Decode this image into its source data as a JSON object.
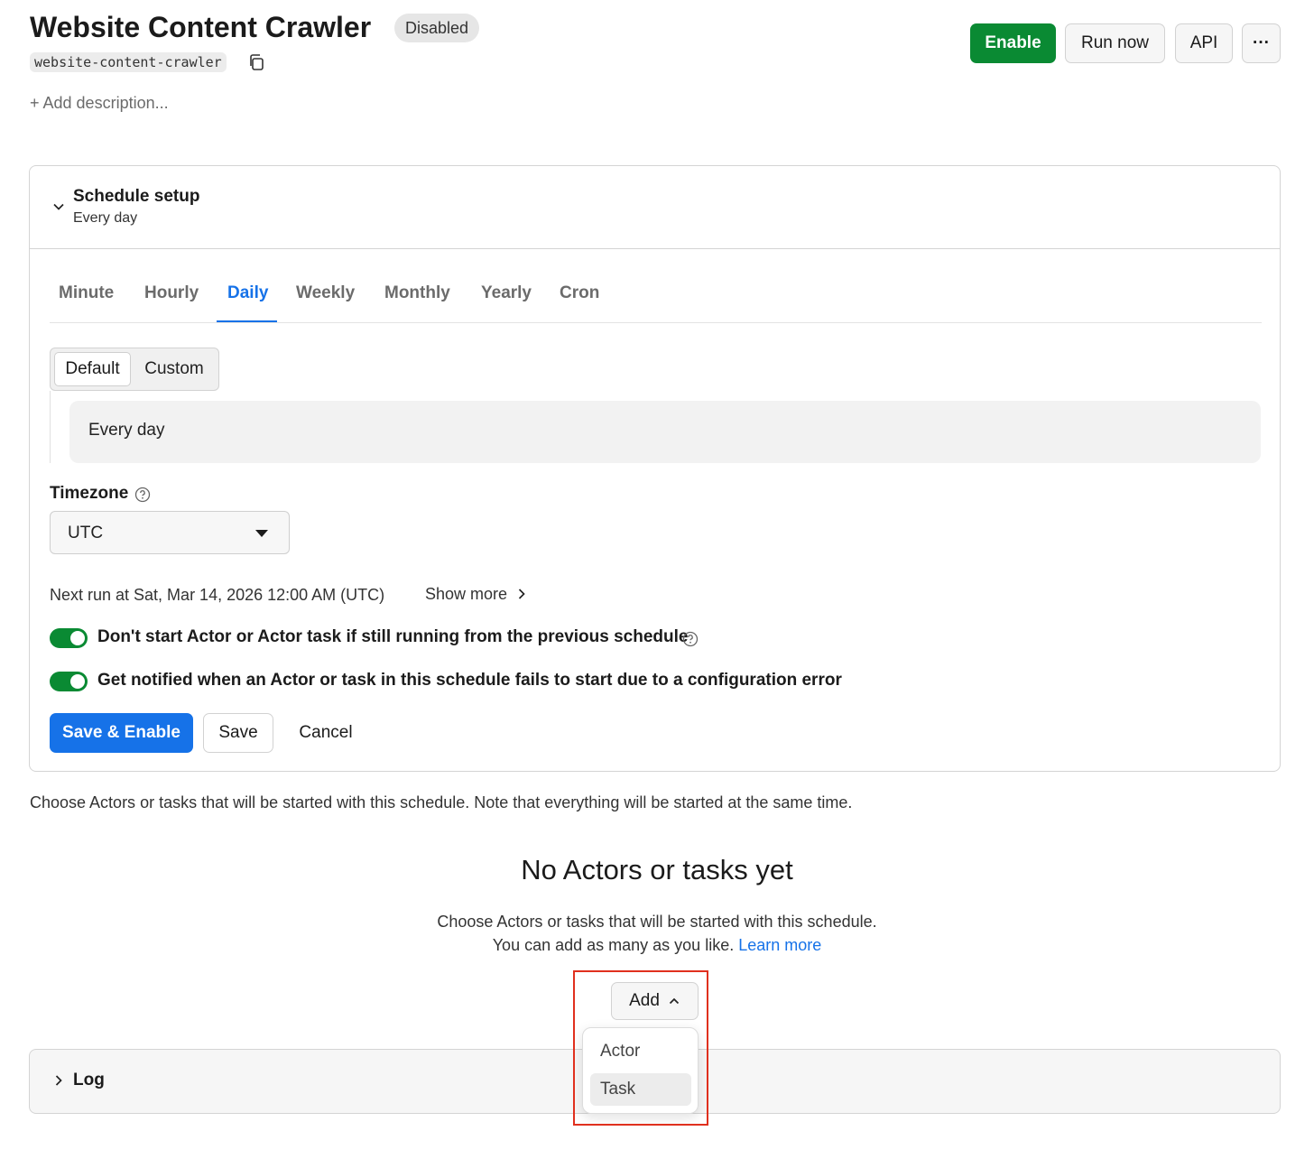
{
  "header": {
    "title": "Website Content Crawler",
    "status_badge": "Disabled",
    "slug": "website-content-crawler",
    "add_description": "+ Add description...",
    "buttons": {
      "enable": "Enable",
      "run_now": "Run now",
      "api": "API",
      "more": "···"
    }
  },
  "schedule": {
    "title": "Schedule setup",
    "subtitle": "Every day",
    "tabs": [
      {
        "label": "Minute"
      },
      {
        "label": "Hourly"
      },
      {
        "label": "Daily"
      },
      {
        "label": "Weekly"
      },
      {
        "label": "Monthly"
      },
      {
        "label": "Yearly"
      },
      {
        "label": "Cron"
      }
    ],
    "active_tab": "Daily",
    "mode": {
      "default": "Default",
      "custom": "Custom",
      "selected": "Default"
    },
    "description": "Every day",
    "timezone": {
      "label": "Timezone",
      "value": "UTC"
    },
    "next_run": "Next run at Sat, Mar 14, 2026 12:00 AM (UTC)",
    "show_more": "Show more",
    "toggles": [
      {
        "label": "Don't start Actor or Actor task if still running from the previous schedule",
        "on": true
      },
      {
        "label": "Get notified when an Actor or task in this schedule fails to start due to a configuration error",
        "on": true
      }
    ],
    "actions": {
      "save_enable": "Save & Enable",
      "save": "Save",
      "cancel": "Cancel"
    }
  },
  "actors": {
    "note": "Choose Actors or tasks that will be started with this schedule. Note that everything will be started at the same time.",
    "empty_title": "No Actors or tasks yet",
    "empty_line1": "Choose Actors or tasks that will be started with this schedule.",
    "empty_line2": "You can add as many as you like.",
    "learn_more": "Learn more",
    "add_button": "Add",
    "menu": [
      {
        "label": "Actor"
      },
      {
        "label": "Task"
      }
    ]
  },
  "log": {
    "title": "Log"
  },
  "colors": {
    "accent": "#1672e8",
    "success": "#0a8a33",
    "highlight": "#e0301e"
  }
}
